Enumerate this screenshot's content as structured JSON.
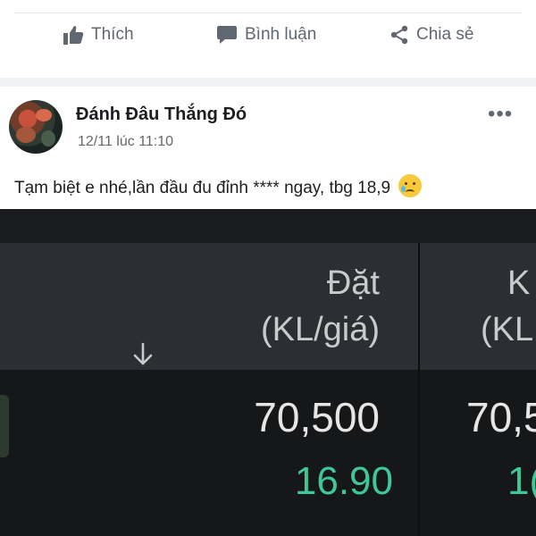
{
  "actions": {
    "like_label": "Thích",
    "comment_label": "Bình luận",
    "share_label": "Chia sẻ"
  },
  "post": {
    "author": "Đánh Đâu Thắng Đó",
    "timestamp": "12/11 lúc 11:10",
    "more_label": "•••",
    "text": "Tạm biệt e nhé,lần đầu đu đỉnh **** ngay, tbg 18,9"
  },
  "trade": {
    "col1_header_1": "Đặt",
    "col1_header_2": "(KL/giá)",
    "col2_header_1": "K",
    "col2_header_2": "(KL",
    "col1_volume": "70,500",
    "col1_price": "16.90",
    "col2_volume": "70,5",
    "col2_price": "1(",
    "colors": {
      "background": "#161719",
      "header": "#2c2e33",
      "price": "#3ec89a",
      "text": "#e6e6e6"
    }
  },
  "icons": {
    "like": "thumbs-up-icon",
    "comment": "comment-bubble-icon",
    "share": "share-icon",
    "emoji": "crying-face-emoji",
    "sort": "arrow-down-icon"
  }
}
